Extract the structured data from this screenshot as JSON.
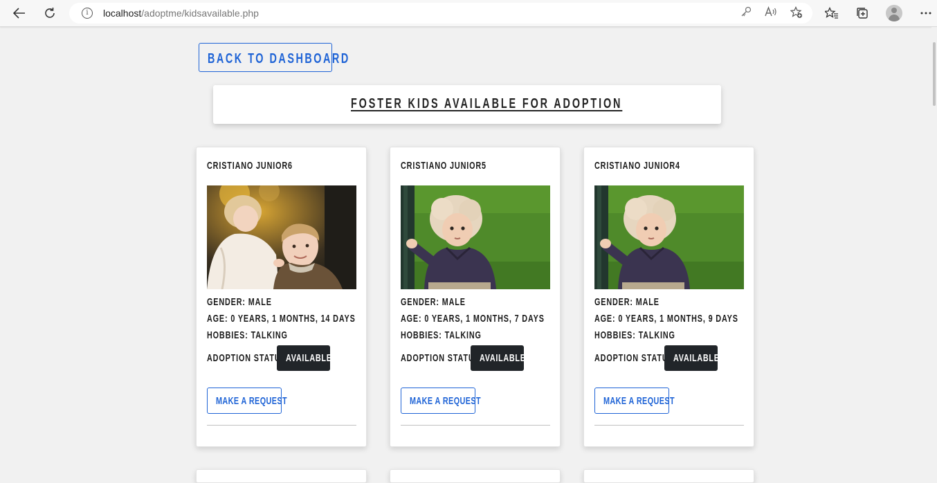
{
  "browser": {
    "url_host": "localhost",
    "url_path": "/adoptme/kidsavailable.php",
    "icons": [
      "back-arrow-icon",
      "refresh-icon",
      "info-icon",
      "key-icon",
      "read-aloud-icon",
      "favorite-add-icon",
      "favorites-icon",
      "collections-icon",
      "profile-avatar",
      "more-menu-icon"
    ]
  },
  "page": {
    "back_button_label": "Back to Dashboard",
    "heading": "FOSTER KIDS AVAILABLE FOR ADOPTION",
    "accent_color": "#1e63d6",
    "badge_color": "#212529"
  },
  "kids": [
    {
      "name": "CRISTIANO  JUNIOR6",
      "gender": "GENDER:  MALE",
      "age": "AGE:  0  YEARS,  1  MONTHS,  14  DAYS",
      "hobbies": "HOBBIES:  TALKING",
      "status_label": "ADOPTION  STATUS:",
      "status": "AVAILABLE",
      "request_label": "MAKE A REQUEST",
      "photo": "two-children-autumn"
    },
    {
      "name": "CRISTIANO  JUNIOR5",
      "gender": "GENDER:  MALE",
      "age": "AGE:  0  YEARS,  1  MONTHS,  7  DAYS",
      "hobbies": "HOBBIES:  TALKING",
      "status_label": "ADOPTION  STATUS:",
      "status": "AVAILABLE",
      "request_label": "MAKE A REQUEST",
      "photo": "toddler-on-grass"
    },
    {
      "name": "CRISTIANO  JUNIOR4",
      "gender": "GENDER:  MALE",
      "age": "AGE:  0  YEARS,  1  MONTHS,  9  DAYS",
      "hobbies": "HOBBIES:  TALKING",
      "status_label": "ADOPTION  STATUS:",
      "status": "AVAILABLE",
      "request_label": "MAKE A REQUEST",
      "photo": "toddler-on-grass"
    }
  ]
}
